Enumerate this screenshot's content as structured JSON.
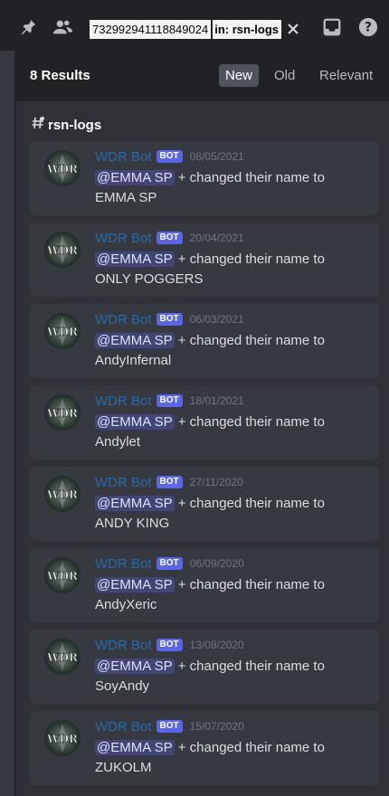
{
  "topbar": {
    "icons": [
      "pin-icon",
      "members-icon",
      "inbox-icon",
      "help-icon"
    ],
    "search_query": "732992941118849024",
    "search_filter": "in: rsn-logs"
  },
  "results": {
    "count_label": "8 Results",
    "sort_tabs": [
      {
        "label": "New",
        "active": true
      },
      {
        "label": "Old",
        "active": false
      },
      {
        "label": "Relevant",
        "active": false
      }
    ],
    "channel": "rsn-logs"
  },
  "colors": {
    "background": "#2f3136",
    "header": "#202225",
    "card": "#36393f",
    "author": "#286aa7",
    "bot_tag": "#5865f2",
    "mention_bg": "#414675"
  },
  "messages": [
    {
      "author": "WDR Bot",
      "tag": "BOT",
      "date": "08/05/2021",
      "mention": "@EMMA SP",
      "text_before": " + changed their name to",
      "new_name": "EMMA SP"
    },
    {
      "author": "WDR Bot",
      "tag": "BOT",
      "date": "20/04/2021",
      "mention": "@EMMA SP",
      "text_before": " + changed their name to",
      "new_name": "ONLY POGGERS"
    },
    {
      "author": "WDR Bot",
      "tag": "BOT",
      "date": "06/03/2021",
      "mention": "@EMMA SP",
      "text_before": " + changed their name to",
      "new_name": "AndyInfernal"
    },
    {
      "author": "WDR Bot",
      "tag": "BOT",
      "date": "18/01/2021",
      "mention": "@EMMA SP",
      "text_before": " + changed their name to",
      "new_name": "Andylet"
    },
    {
      "author": "WDR Bot",
      "tag": "BOT",
      "date": "27/11/2020",
      "mention": "@EMMA SP",
      "text_before": " + changed their name to",
      "new_name": "ANDY KING"
    },
    {
      "author": "WDR Bot",
      "tag": "BOT",
      "date": "06/09/2020",
      "mention": "@EMMA SP",
      "text_before": " + changed their name to",
      "new_name": "AndyXeric"
    },
    {
      "author": "WDR Bot",
      "tag": "BOT",
      "date": "13/08/2020",
      "mention": "@EMMA SP",
      "text_before": " + changed their name to",
      "new_name": "SoyAndy"
    },
    {
      "author": "WDR Bot",
      "tag": "BOT",
      "date": "15/07/2020",
      "mention": "@EMMA SP",
      "text_before": " + changed their name to",
      "new_name": "ZUKOLM"
    }
  ],
  "avatar_text": "WDR"
}
